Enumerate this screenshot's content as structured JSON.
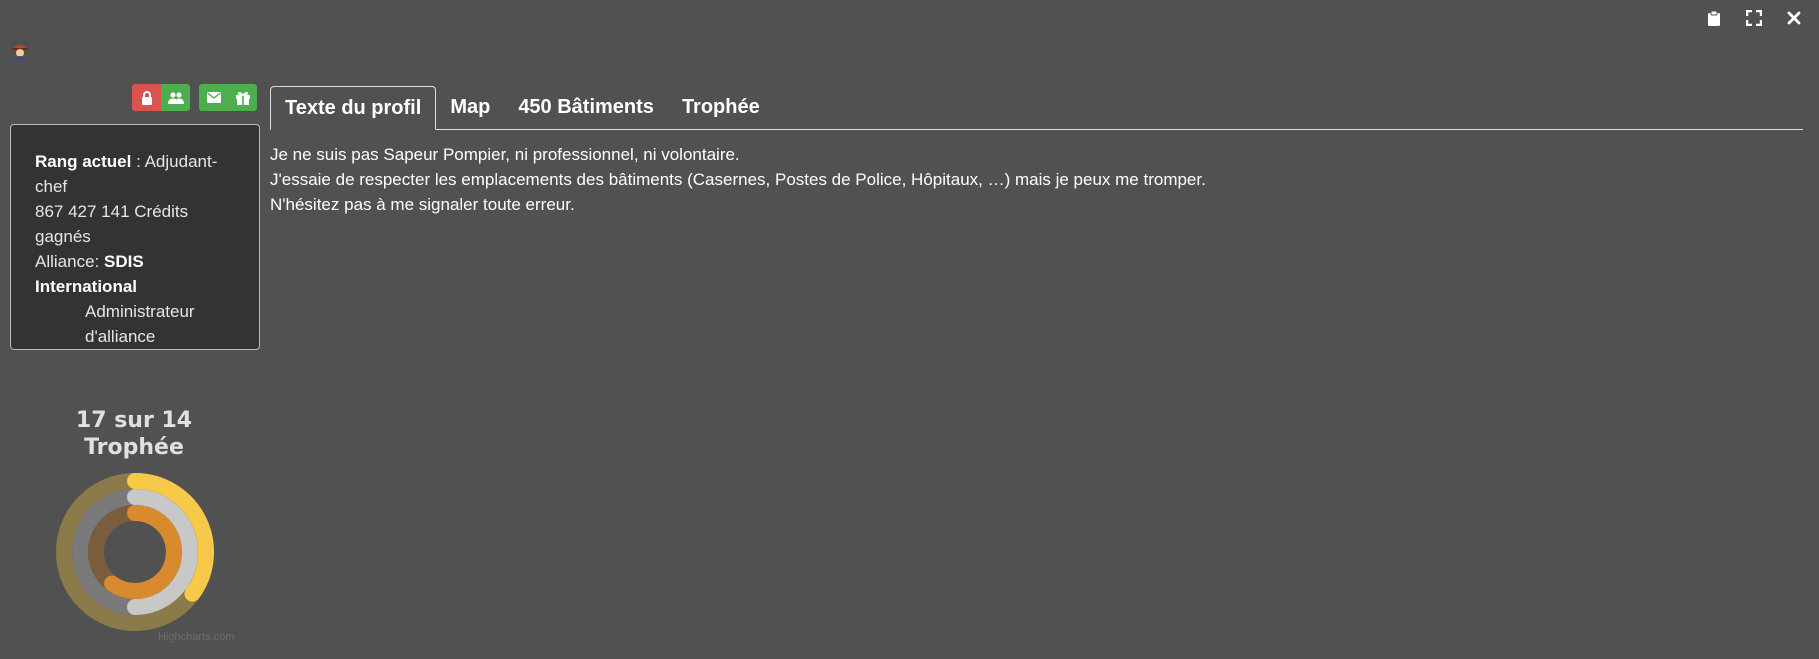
{
  "window_controls": {
    "clipboard_icon": "clipboard-icon",
    "fullscreen_icon": "fullscreen-icon",
    "close_icon": "close-icon"
  },
  "avatar": {
    "icon": "firefighter-avatar-icon"
  },
  "action_buttons": [
    {
      "icon": "lock-icon",
      "color": "#d9534f"
    },
    {
      "icon": "users-icon",
      "color": "#4cae4c"
    },
    {
      "icon": "envelope-icon",
      "color": "#4cae4c"
    },
    {
      "icon": "gift-icon",
      "color": "#4cae4c"
    }
  ],
  "profile": {
    "rank_label": "Rang actuel",
    "rank_sep": " : ",
    "rank_value": "Adjudant-chef",
    "credits": "867 427 141 Crédits gagnés",
    "alliance_label": "Alliance: ",
    "alliance_name": "SDIS International",
    "alliance_role": "Administrateur d'alliance"
  },
  "trophy_summary": {
    "line1": "17 sur 14",
    "line2": "Trophée",
    "credits_text": "Highcharts.com"
  },
  "tabs": [
    {
      "label": "Texte du profil",
      "active": true
    },
    {
      "label": "Map",
      "active": false
    },
    {
      "label": "450 Bâtiments",
      "active": false
    },
    {
      "label": "Trophée",
      "active": false
    }
  ],
  "profile_text": [
    "Je ne suis pas Sapeur Pompier, ni professionnel, ni volontaire.",
    "J'essaie de respecter les emplacements des bâtiments (Casernes, Postes de Police, Hôpitaux, …) mais je peux me tromper.",
    "N'hésitez pas à me signaler toute erreur."
  ],
  "chart_data": {
    "type": "radial-bar",
    "series": [
      {
        "value": 0.35,
        "color": "#f7c948",
        "track_color": "#8c7b4a"
      },
      {
        "value": 0.5,
        "color": "#c8c8c8",
        "track_color": "#7a7a7a"
      },
      {
        "value": 0.6,
        "color": "#d98a2e",
        "track_color": "#7a5d3d"
      }
    ]
  }
}
